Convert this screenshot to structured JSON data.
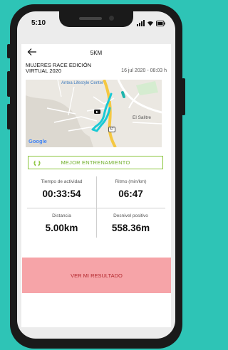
{
  "status_bar": {
    "time": "5:10"
  },
  "header": {
    "title": "5KM"
  },
  "race": {
    "name": "MUJERES RACE EDICIÓN VIRTUAL 2020",
    "date": "16 jul 2020 - 08:03 h"
  },
  "map": {
    "label_center": "Antea Lifestyle Center",
    "label_town": "El Salitre",
    "route_shield": "57",
    "provider": "Google",
    "route_color": "#19c9d4"
  },
  "badge": {
    "label": "MEJOR ENTRENAMIENTO",
    "color": "#8cc63f"
  },
  "stats": [
    {
      "label": "Tiempo de actividad",
      "value": "00:33:54"
    },
    {
      "label": "Ritmo (min/km)",
      "value": "06:47"
    },
    {
      "label": "Distancia",
      "value": "5.00km"
    },
    {
      "label": "Desnivel positivo",
      "value": "558.36m"
    }
  ],
  "action": {
    "label": "VER MI RESULTADO",
    "color": "#f6a4a8"
  },
  "icons": [
    "back-arrow-icon",
    "signal-icon",
    "wifi-icon",
    "battery-icon",
    "laurel-icon"
  ]
}
